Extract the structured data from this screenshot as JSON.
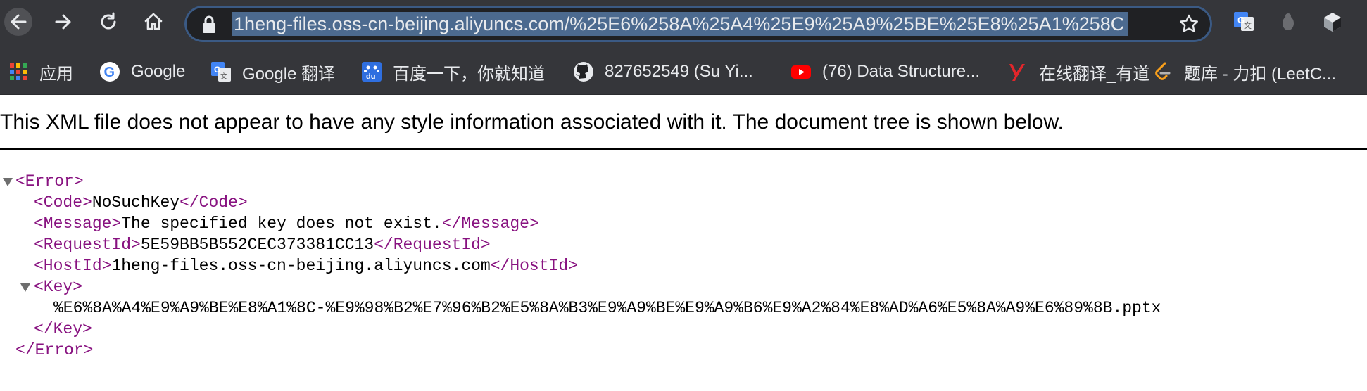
{
  "browser": {
    "url": "1heng-files.oss-cn-beijing.aliyuncs.com/%25E6%258A%25A4%25E9%25A9%25BE%25E8%25A1%258C",
    "icons": {
      "back": "back-arrow-icon",
      "forward": "forward-arrow-icon",
      "reload": "reload-icon",
      "home": "home-icon",
      "lock": "lock-icon",
      "bookmark": "star-icon",
      "extensions": [
        "google-translate-icon",
        "bug-extension-icon",
        "cube-extension-icon"
      ]
    },
    "colors": {
      "toolbar": "#35363a",
      "omnibox": "#202124",
      "selection": "#4c6a8f"
    }
  },
  "bookmarks": [
    {
      "label": "应用",
      "icon": "apps-grid-icon"
    },
    {
      "label": "Google",
      "icon": "google-icon"
    },
    {
      "label": "Google 翻译",
      "icon": "google-translate-icon"
    },
    {
      "label": "百度一下，你就知道",
      "icon": "baidu-icon"
    },
    {
      "label": "827652549 (Su Yi...",
      "icon": "github-icon"
    },
    {
      "label": "(76) Data Structure...",
      "icon": "youtube-icon"
    },
    {
      "label": "在线翻译_有道",
      "icon": "youdao-icon"
    },
    {
      "label": "题库 - 力扣 (LeetC...",
      "icon": "leetcode-icon"
    }
  ],
  "page": {
    "banner": "This XML file does not appear to have any style information associated with it. The document tree is shown below.",
    "xml": {
      "error_open": "<Error>",
      "error_close": "</Error>",
      "code_open": "<Code>",
      "code_value": "NoSuchKey",
      "code_close": "</Code>",
      "message_open": "<Message>",
      "message_value": "The specified key does not exist.",
      "message_close": "</Message>",
      "requestid_open": "<RequestId>",
      "requestid_value": "5E59BB5B552CEC373381CC13",
      "requestid_close": "</RequestId>",
      "hostid_open": "<HostId>",
      "hostid_value": "1heng-files.oss-cn-beijing.aliyuncs.com",
      "hostid_close": "</HostId>",
      "key_open": "<Key>",
      "key_value": "%E6%8A%A4%E9%A9%BE%E8%A1%8C-%E9%98%B2%E7%96%B2%E5%8A%B3%E9%A9%BE%E9%A9%B6%E9%A2%84%E8%AD%A6%E5%8A%A9%E6%89%8B.pptx",
      "key_close": "</Key>"
    }
  }
}
